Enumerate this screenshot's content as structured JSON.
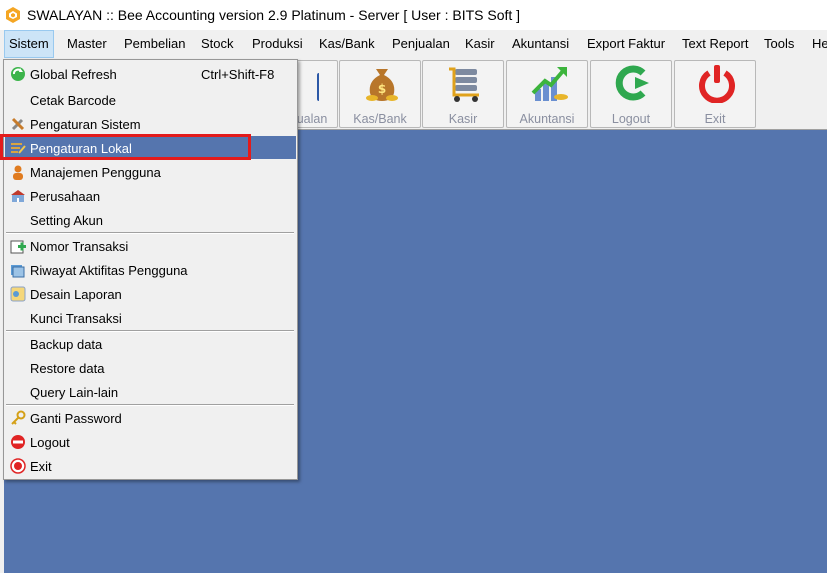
{
  "window": {
    "title": "SWALAYAN :: Bee Accounting version 2.9 Platinum - Server  [ User : BITS Soft ]"
  },
  "menubar": {
    "items": [
      {
        "label": "Sistem"
      },
      {
        "label": "Master"
      },
      {
        "label": "Pembelian"
      },
      {
        "label": "Stock"
      },
      {
        "label": "Produksi"
      },
      {
        "label": "Kas/Bank"
      },
      {
        "label": "Penjualan"
      },
      {
        "label": "Kasir"
      },
      {
        "label": "Akuntansi"
      },
      {
        "label": "Export Faktur"
      },
      {
        "label": "Text Report"
      },
      {
        "label": "Tools"
      },
      {
        "label": "He"
      }
    ]
  },
  "toolbar": {
    "buttons": [
      {
        "label": "ualan",
        "icon": "shopping-bag-icon"
      },
      {
        "label": "Kas/Bank",
        "icon": "money-bag-icon"
      },
      {
        "label": "Kasir",
        "icon": "cart-icon"
      },
      {
        "label": "Akuntansi",
        "icon": "growth-chart-icon"
      },
      {
        "label": "Logout",
        "icon": "logout-arrow-icon"
      },
      {
        "label": "Exit",
        "icon": "power-icon"
      }
    ]
  },
  "dropdown": {
    "items": [
      {
        "label": "Global Refresh",
        "shortcut": "Ctrl+Shift-F8",
        "icon": "refresh-icon"
      },
      {
        "label": "Cetak Barcode"
      },
      {
        "label": "Pengaturan Sistem",
        "icon": "tools-icon"
      },
      {
        "label": "Pengaturan Lokal",
        "icon": "edit-icon",
        "highlighted": true
      },
      {
        "label": "Manajemen Pengguna",
        "icon": "user-icon"
      },
      {
        "label": "Perusahaan",
        "icon": "building-icon"
      },
      {
        "label": "Setting Akun"
      },
      {
        "label": "Nomor Transaksi",
        "icon": "add-document-icon"
      },
      {
        "label": "Riwayat Aktifitas Pengguna",
        "icon": "history-icon"
      },
      {
        "label": "Desain Laporan",
        "icon": "report-design-icon"
      },
      {
        "label": "Kunci Transaksi"
      },
      {
        "label": "Backup data"
      },
      {
        "label": "Restore data"
      },
      {
        "label": "Query Lain-lain"
      },
      {
        "label": "Ganti Password",
        "icon": "key-icon"
      },
      {
        "label": "Logout",
        "icon": "no-entry-icon"
      },
      {
        "label": "Exit",
        "icon": "exit-icon"
      }
    ]
  },
  "colors": {
    "workspace": "#5575ae",
    "highlight_border": "#e31b1b",
    "menu_background": "#f0f0f0"
  }
}
